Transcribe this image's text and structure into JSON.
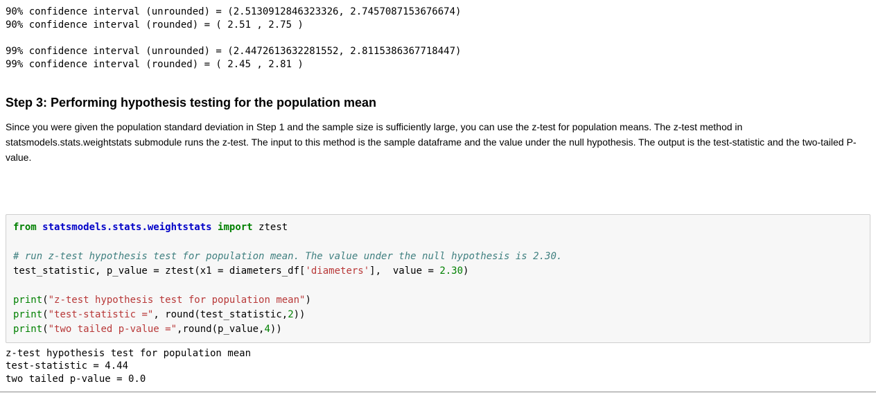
{
  "output_top": {
    "l1": "90% confidence interval (unrounded) = (2.5130912846323326, 2.7457087153676674)",
    "l2": "90% confidence interval (rounded) = ( 2.51 , 2.75 )",
    "l3": "99% confidence interval (unrounded) = (2.4472613632281552, 2.8115386367718447)",
    "l4": "99% confidence interval (rounded) = ( 2.45 , 2.81 )"
  },
  "heading": "Step 3: Performing hypothesis testing for the population mean",
  "prose": "Since you were given the population standard deviation in Step 1 and the sample size is sufficiently large, you can use the z-test for population means. The z-test method in statsmodels.stats.weightstats submodule runs the z-test. The input to this method is the sample dataframe and the value under the null hypothesis. The output is the test-statistic and the two-tailed P-value.",
  "code": {
    "kw_from": "from",
    "mod_path": "statsmodels.stats.weightstats",
    "kw_import": "import",
    "fn_ztest": "ztest",
    "comment": "# run z-test hypothesis test for population mean. The value under the null hypothesis is 2.30.",
    "assign_lhs": "test_statistic, p_value = ztest(x1 = diameters_df[",
    "str_diam": "'diameters'",
    "assign_tail": "],  value = ",
    "val_230": "2.30",
    "close_paren": ")",
    "print1_builtin": "print",
    "print1_open": "(",
    "print1_str": "\"z-test hypothesis test for population mean\"",
    "print1_close": ")",
    "print2_open": "(",
    "print2_str": "\"test-statistic =\"",
    "print2_tail": ", round(test_statistic,",
    "print2_num": "2",
    "print2_close": "))",
    "print3_open": "(",
    "print3_str": "\"two tailed p-value =\"",
    "print3_tail": ",round(p_value,",
    "print3_num": "4",
    "print3_close": "))"
  },
  "output_bottom": {
    "l1": "z-test hypothesis test for population mean",
    "l2": "test-statistic = 4.44",
    "l3": "two tailed p-value = 0.0"
  }
}
